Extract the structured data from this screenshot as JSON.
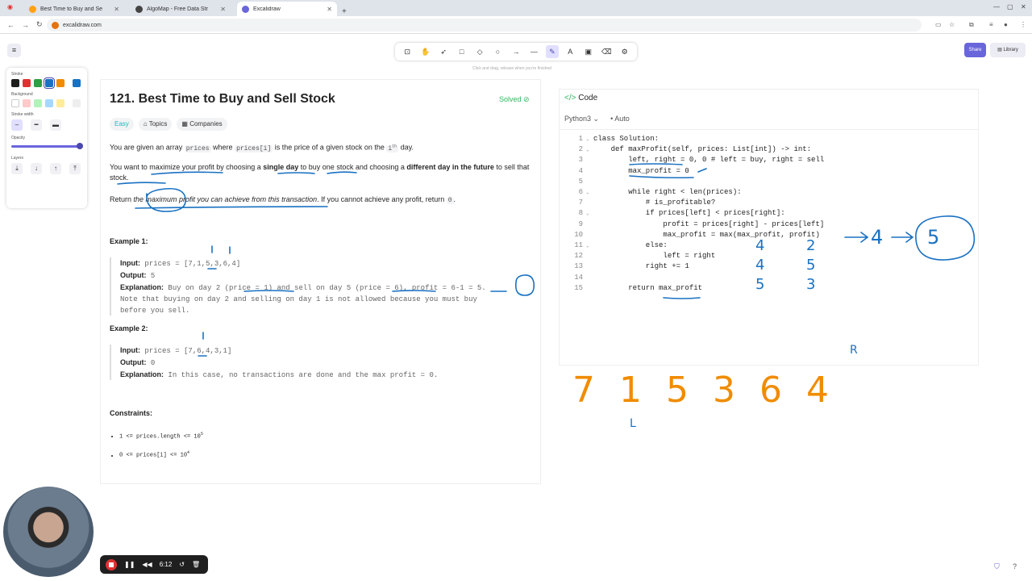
{
  "browser": {
    "tabs": [
      {
        "title": "Best Time to Buy and Se",
        "favicon_color": "#ffa116"
      },
      {
        "title": "AlgoMap - Free Data Str",
        "favicon_color": "#444444"
      },
      {
        "title": "Excalidraw",
        "favicon_color": "#6965db"
      }
    ],
    "url": "excalidraw.com"
  },
  "excalidraw": {
    "hint": "Click and drag, release when you're finished",
    "share_label": "Share",
    "library_label": "Library",
    "props": {
      "stroke": "Stroke",
      "background": "Background",
      "stroke_width": "Stroke width",
      "opacity": "Opacity",
      "layers": "Layers",
      "stroke_colors": [
        "#1e1e1e",
        "#e03131",
        "#2f9e44",
        "#1971c2",
        "#f08c00",
        "#1971c2"
      ],
      "bg_colors": [
        "#ffffff",
        "#ffc9c9",
        "#b2f2bb",
        "#a5d8ff",
        "#ffec99"
      ]
    }
  },
  "problem": {
    "title": "121. Best Time to Buy and Sell Stock",
    "status": "Solved",
    "difficulty": "Easy",
    "topics": "Topics",
    "companies": "Companies",
    "p1_a": "You are given an array ",
    "p1_code1": "prices",
    "p1_b": " where ",
    "p1_code2": "prices[i]",
    "p1_c": " is the price of a given stock on the ",
    "p1_sup": "i",
    "p1_th": "th",
    "p1_d": " day.",
    "p2_a": "You want to maximize your profit by choosing a ",
    "p2_b": "single day",
    "p2_c": " to buy one stock and choosing a ",
    "p2_d": "different day in the future",
    "p2_e": " to sell that stock.",
    "p3_a": "Return ",
    "p3_b": "the maximum profit you can achieve from this transaction",
    "p3_c": ". If you cannot achieve any profit, return ",
    "p3_code": "0",
    "p3_d": ".",
    "ex1_title": "Example 1:",
    "ex1_input_label": "Input:",
    "ex1_input": "prices = [7,1,5,3,6,4]",
    "ex1_output_label": "Output:",
    "ex1_output": "5",
    "ex1_expl_label": "Explanation:",
    "ex1_expl": "Buy on day 2 (price = 1) and sell on day 5 (price = 6), profit = 6-1 = 5.",
    "ex1_expl2": "Note that buying on day 2 and selling on day 1 is not allowed because you must buy",
    "ex1_expl3": "before you sell.",
    "ex2_title": "Example 2:",
    "ex2_input_label": "Input:",
    "ex2_input": "prices = [7,6,4,3,1]",
    "ex2_output_label": "Output:",
    "ex2_output": "0",
    "ex2_expl_label": "Explanation:",
    "ex2_expl": "In this case, no transactions are done and the max profit = 0.",
    "constraints_title": "Constraints:",
    "c1": "1 <= prices.length <= 10",
    "c1_sup": "5",
    "c2": "0 <= prices[i] <= 10",
    "c2_sup": "4"
  },
  "code": {
    "header": "Code",
    "language": "Python3",
    "mode": "Auto",
    "lines": [
      "class Solution:",
      "    def maxProfit(self, prices: List[int]) -> int:",
      "        left, right = 0, 0 # left = buy, right = sell",
      "        max_profit = 0",
      "",
      "        while right < len(prices):",
      "            # is_profitable?",
      "            if prices[left] < prices[right]:",
      "                profit = prices[right] - prices[left]",
      "                max_profit = max(max_profit, profit)",
      "            else:",
      "                left = right",
      "            right += 1",
      "",
      "        return max_profit"
    ]
  },
  "drawing": {
    "prices": [
      "7",
      "1",
      "5",
      "3",
      "6",
      "4"
    ],
    "pointer_r": "R",
    "pointer_l": "L",
    "col_a": [
      "4",
      "4",
      "5"
    ],
    "col_b": [
      "2",
      "5",
      "3"
    ],
    "chain_mid": "4",
    "chain_end": "5"
  },
  "recorder": {
    "time": "6:12"
  }
}
